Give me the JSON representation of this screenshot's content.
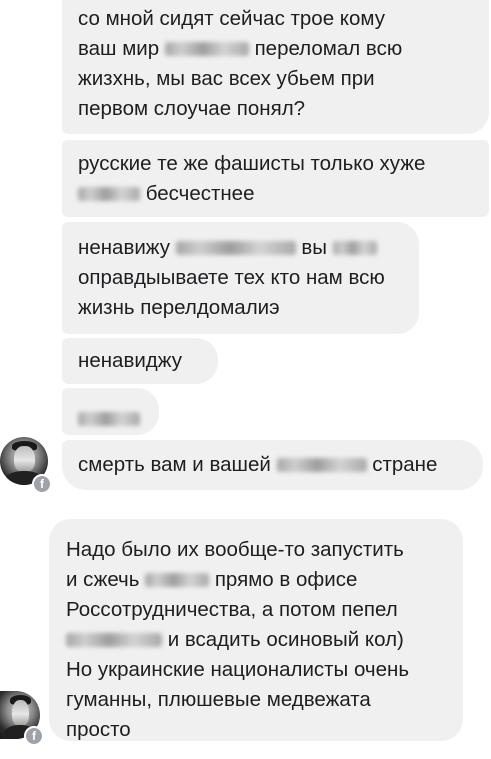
{
  "thread1": {
    "messages": [
      {
        "line1_a": "со мной сидят сейчас трое кому",
        "line2_a": "ваш мир",
        "line2_b": "переломал всю",
        "line3": "жизхнь, мы вас всех убьем при",
        "line4": "первом слоучае понял?"
      },
      {
        "line1": "русские те же фашисты только хуже",
        "line2_b": "бесчестнее"
      },
      {
        "line1_a": "ненавижу",
        "line1_b": "вы",
        "line2": "оправдыываете тех кто нам всю",
        "line3": "жизнь перелдомалиэ"
      },
      {
        "line1": "ненавиджу"
      },
      {
        "redacted": true
      },
      {
        "line1_a": "смерть вам и вашей",
        "line1_b": "стране"
      }
    ],
    "avatar_icon": "user-avatar-icon",
    "badge_icon": "facebook-badge-icon",
    "badge_glyph": "f"
  },
  "thread2": {
    "message": {
      "line1": "Надо было их вообще-то запустить",
      "line2_a": "и сжечь",
      "line2_b": "прямо в офисе",
      "line3": "Россотрудничества, а потом пепел",
      "line4_b": "и всадить осиновый кол)",
      "line5": "Но украинские националисты очень",
      "line6": "гуманны, плюшевые медвежата",
      "line7": "просто"
    },
    "avatar_icon": "user-avatar-icon",
    "badge_icon": "facebook-badge-icon",
    "badge_glyph": "f"
  },
  "colors": {
    "bubble_bg": "#f1f0f0",
    "text": "#1c1e21",
    "background": "#ffffff",
    "badge": "#9ea3aa"
  }
}
